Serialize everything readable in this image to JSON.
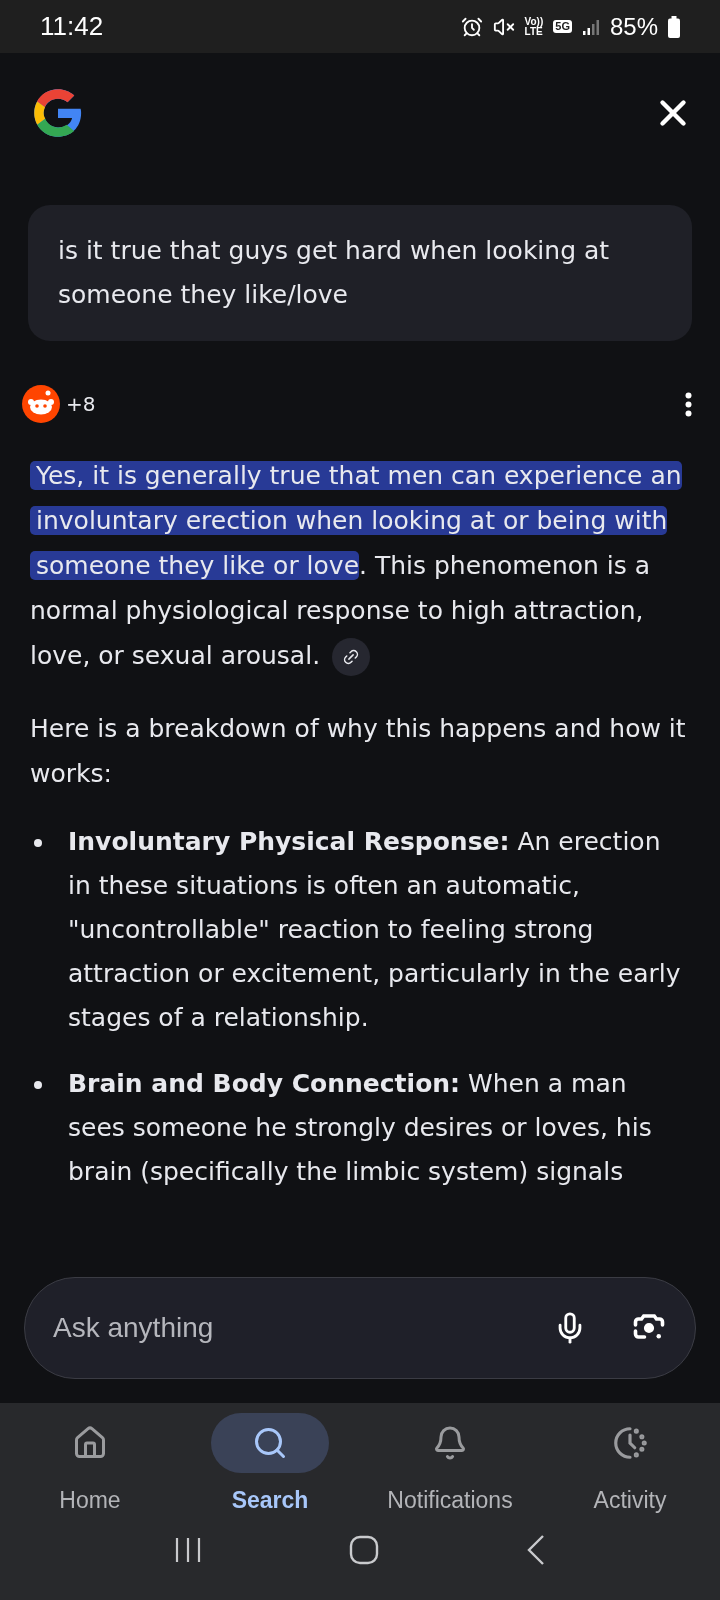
{
  "status_bar": {
    "time": "11:42",
    "volte": [
      "Vo))",
      "LTE"
    ],
    "network": "5G",
    "battery": "85%"
  },
  "query": "is it true that guys get hard when looking at someone they like/love",
  "sources": {
    "count": "+8"
  },
  "answer": {
    "highlighted": "Yes, it is generally true that men can experience an involuntary erection when looking at or being with someone they like or love",
    "rest": ". This phenomenon is a normal physiological response to high attraction, love, or sexual arousal."
  },
  "intro": "Here is a breakdown of why this happens and how it works:",
  "bullets": [
    {
      "text": "**Involuntary Physical Response:** An erection in these situations is often an automatic, \"uncontrollable\" reaction to feeling strong attraction or excitement, particularly in the early stages of a relationship."
    },
    {
      "text": "**Brain and Body Connection:** When a man sees someone he strongly desires or loves, his brain (specifically the limbic system) signals"
    }
  ],
  "ask": {
    "placeholder": "Ask anything"
  },
  "nav": [
    {
      "label": "Home",
      "kind": "home",
      "selected": false
    },
    {
      "label": "Search",
      "kind": "search",
      "selected": true
    },
    {
      "label": "Notifications",
      "kind": "bell",
      "selected": false
    },
    {
      "label": "Activity",
      "kind": "activity",
      "selected": false
    }
  ]
}
